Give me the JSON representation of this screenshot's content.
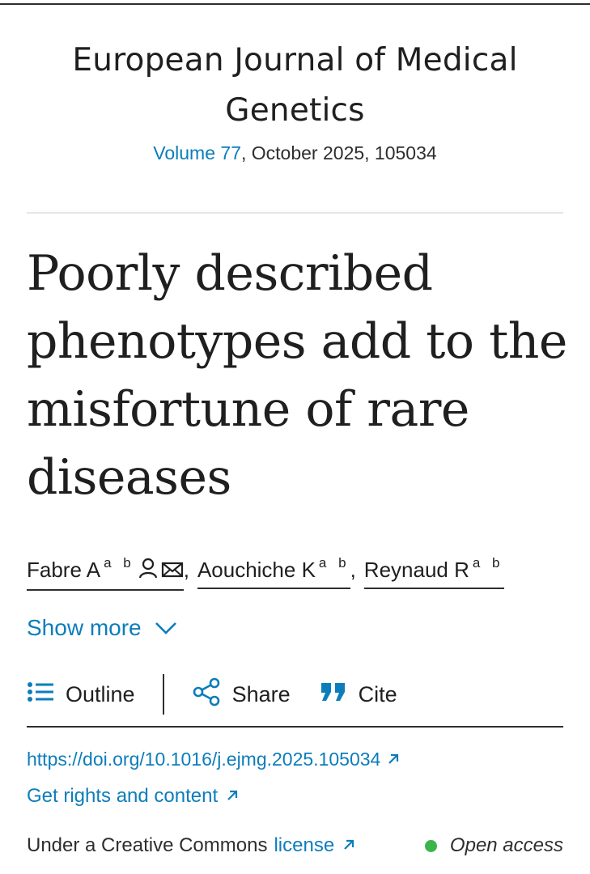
{
  "journal": {
    "title": "European Journal of Medical Genetics",
    "volume_link": "Volume 77",
    "meta_rest": ", October 2025, 105034"
  },
  "article": {
    "title": "Poorly described phenotypes add to the misfortune of rare diseases"
  },
  "authors": [
    {
      "name": "Fabre A",
      "affil": "a b"
    },
    {
      "name": "Aouchiche K",
      "affil": "a b"
    },
    {
      "name": "Reynaud R",
      "affil": "a b"
    }
  ],
  "author_sep": ",",
  "show_more": {
    "label": "Show more"
  },
  "toolbar": {
    "outline_label": "Outline",
    "share_label": "Share",
    "cite_label": "Cite"
  },
  "doi": {
    "url": "https://doi.org/10.1016/j.ejmg.2025.105034"
  },
  "rights": {
    "label": "Get rights and content"
  },
  "license": {
    "prefix": "Under a Creative Commons",
    "link": "license",
    "status": "Open access"
  },
  "colors": {
    "link": "#0c7dbb",
    "open_access_dot": "#3ab54a",
    "text": "#1f1f1f"
  },
  "icons": [
    "user-icon",
    "mail-icon",
    "chevron-down-icon",
    "list-icon",
    "share-icon",
    "quote-icon",
    "external-link-icon"
  ]
}
